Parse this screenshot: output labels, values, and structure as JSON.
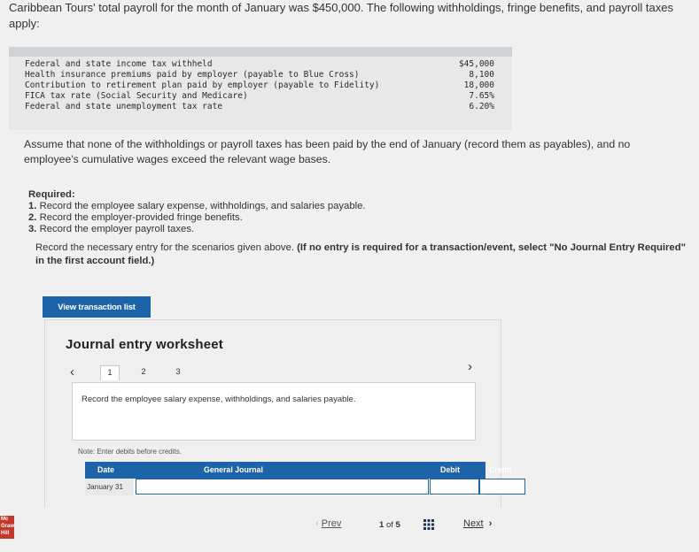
{
  "intro": "Caribbean Tours' total payroll for the month of January was $450,000. The following withholdings, fringe benefits, and payroll taxes apply:",
  "withholdings": [
    {
      "label": "Federal and state income tax withheld",
      "value": "$45,000"
    },
    {
      "label": "Health insurance premiums paid by employer (payable to Blue Cross)",
      "value": "8,100"
    },
    {
      "label": "Contribution to retirement plan paid by employer (payable to Fidelity)",
      "value": "18,000"
    },
    {
      "label": "FICA tax rate (Social Security and Medicare)",
      "value": "7.65%"
    },
    {
      "label": "Federal and state unemployment tax rate",
      "value": "6.20%"
    }
  ],
  "assume": "Assume that none of the withholdings or payroll taxes has been paid by the end of January (record them as payables), and no employee's cumulative wages exceed the relevant wage bases.",
  "required": {
    "header": "Required:",
    "items": [
      {
        "num": "1.",
        "text": "Record the employee salary expense, withholdings, and salaries payable."
      },
      {
        "num": "2.",
        "text": "Record the employer-provided fringe benefits."
      },
      {
        "num": "3.",
        "text": "Record the employer payroll taxes."
      }
    ]
  },
  "instruction": {
    "text": "Record the necessary entry for the scenarios given above.",
    "bold": "(If no entry is required for a transaction/event, select \"No Journal Entry Required\" in the first account field.)"
  },
  "view_button": "View transaction list",
  "worksheet": {
    "title": "Journal entry worksheet",
    "pages": [
      "1",
      "2",
      "3"
    ],
    "active_page": "1",
    "task": "Record the employee salary expense, withholdings, and salaries payable.",
    "note": "Note: Enter debits before credits.",
    "columns": {
      "date": "Date",
      "general_journal": "General Journal",
      "debit": "Debit",
      "credit": "Credit"
    },
    "rows": [
      {
        "date": "January 31"
      }
    ]
  },
  "navigation": {
    "prev": "Prev",
    "page_current": "1",
    "page_of": "of",
    "page_total": "5",
    "next": "Next"
  },
  "logo_text": "Mc Graw Hill",
  "colors": {
    "accent": "#1d63a8",
    "brand": "#c0392b"
  }
}
